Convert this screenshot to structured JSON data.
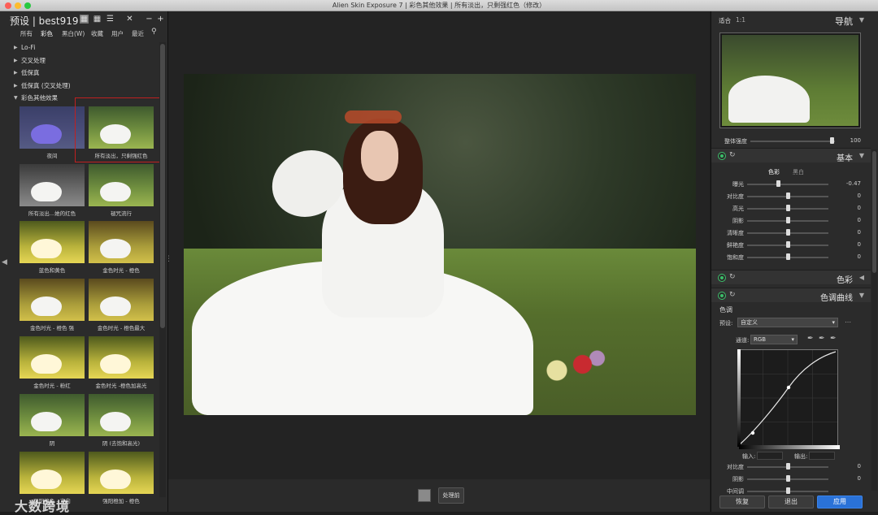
{
  "window": {
    "title": "Alien Skin Exposure 7 | 彩色其他效果 | 所有淡出，只剩强红色（修改）"
  },
  "left": {
    "title": "预设 | best919",
    "filters": [
      "所有",
      "彩色",
      "黑白(W)",
      "收藏",
      "用户",
      "最近"
    ],
    "categories": [
      {
        "label": "Lo-Fi",
        "expanded": false
      },
      {
        "label": "交叉处理",
        "expanded": false
      },
      {
        "label": "低保真",
        "expanded": false
      },
      {
        "label": "低保真 (交叉处理)",
        "expanded": false
      },
      {
        "label": "彩色其他效果",
        "expanded": true
      }
    ],
    "thumbs": [
      {
        "caption": "夜间"
      },
      {
        "caption": "所有淡出，只剩强红色"
      },
      {
        "caption": "所有淡出...她的红色"
      },
      {
        "caption": "褪咒流行"
      },
      {
        "caption": "蓝色和黄色"
      },
      {
        "caption": "金色时光 - 橙色"
      },
      {
        "caption": "金色时光 - 橙色 强"
      },
      {
        "caption": "金色时光 - 橙色最大"
      },
      {
        "caption": "金色时光 - 粉红"
      },
      {
        "caption": "金色时光 -橙色加高光"
      },
      {
        "caption": "阴"
      },
      {
        "caption": "阴 (去饱和高光)"
      },
      {
        "caption": "强阳橙色 - 方向"
      },
      {
        "caption": "强阳橙加 - 橙色"
      }
    ]
  },
  "center": {
    "compare_label": "处理前"
  },
  "right": {
    "nav": {
      "fit": "适合",
      "ratio": "1:1",
      "title": "导航"
    },
    "overall": {
      "label": "整体强度",
      "value": "100",
      "level": 1.0
    },
    "basic": {
      "title": "基本",
      "mode_color": "色彩",
      "mode_bw": "黑白",
      "sliders": [
        {
          "label": "曝光",
          "value": "-0.47",
          "pos": 0.38
        },
        {
          "label": "对比度",
          "value": "0",
          "pos": 0.5
        },
        {
          "label": "高光",
          "value": "0",
          "pos": 0.5
        },
        {
          "label": "阴影",
          "value": "0",
          "pos": 0.5
        },
        {
          "label": "清晰度",
          "value": "0",
          "pos": 0.5
        },
        {
          "label": "鲜艳度",
          "value": "0",
          "pos": 0.5
        },
        {
          "label": "饱和度",
          "value": "0",
          "pos": 0.5
        }
      ]
    },
    "color": {
      "title": "色彩"
    },
    "curves": {
      "title": "色调曲线",
      "sub": "色调",
      "preset_label": "预设:",
      "preset_value": "自定义",
      "channel_label": "通道:",
      "channel_value": "RGB",
      "input_label": "输入:",
      "output_label": "输出:",
      "sliders": [
        {
          "label": "对比度",
          "value": "0",
          "pos": 0.5
        },
        {
          "label": "阴影",
          "value": "0",
          "pos": 0.5
        },
        {
          "label": "中间调",
          "value": "",
          "pos": 0.5
        }
      ]
    },
    "buttons": {
      "reset": "恢复",
      "exit": "退出",
      "apply": "应用"
    }
  },
  "watermark": "大数跨境",
  "colors": {
    "accent": "#2a72d8",
    "selection": "#c02020",
    "active_icon": "#3cbf6a"
  }
}
